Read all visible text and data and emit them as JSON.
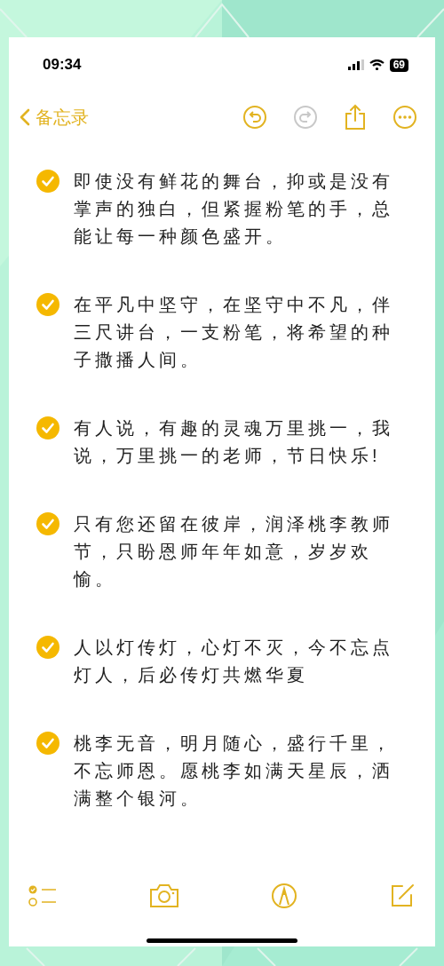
{
  "status_bar": {
    "time": "09:34",
    "battery": "69"
  },
  "nav": {
    "back_label": "备忘录",
    "undo_enabled": true,
    "redo_enabled": false
  },
  "checklist": [
    {
      "text": "即使没有鲜花的舞台，抑或是没有掌声的独白，但紧握粉笔的手，总能让每一种颜色盛开。",
      "checked": true
    },
    {
      "text": "在平凡中坚守，在坚守中不凡，伴三尺讲台，一支粉笔，将希望的种子撒播人间。",
      "checked": true
    },
    {
      "text": "有人说，有趣的灵魂万里挑一，我说，万里挑一的老师，节日快乐!",
      "checked": true
    },
    {
      "text": "只有您还留在彼岸，润泽桃李教师节，只盼恩师年年如意，岁岁欢愉。",
      "checked": true
    },
    {
      "text": "人以灯传灯，心灯不灭，今不忘点灯人，后必传灯共燃华夏",
      "checked": true
    },
    {
      "text": "桃李无音，明月随心，盛行千里，不忘师恩。愿桃李如满天星辰，洒满整个银河。",
      "checked": true
    }
  ]
}
